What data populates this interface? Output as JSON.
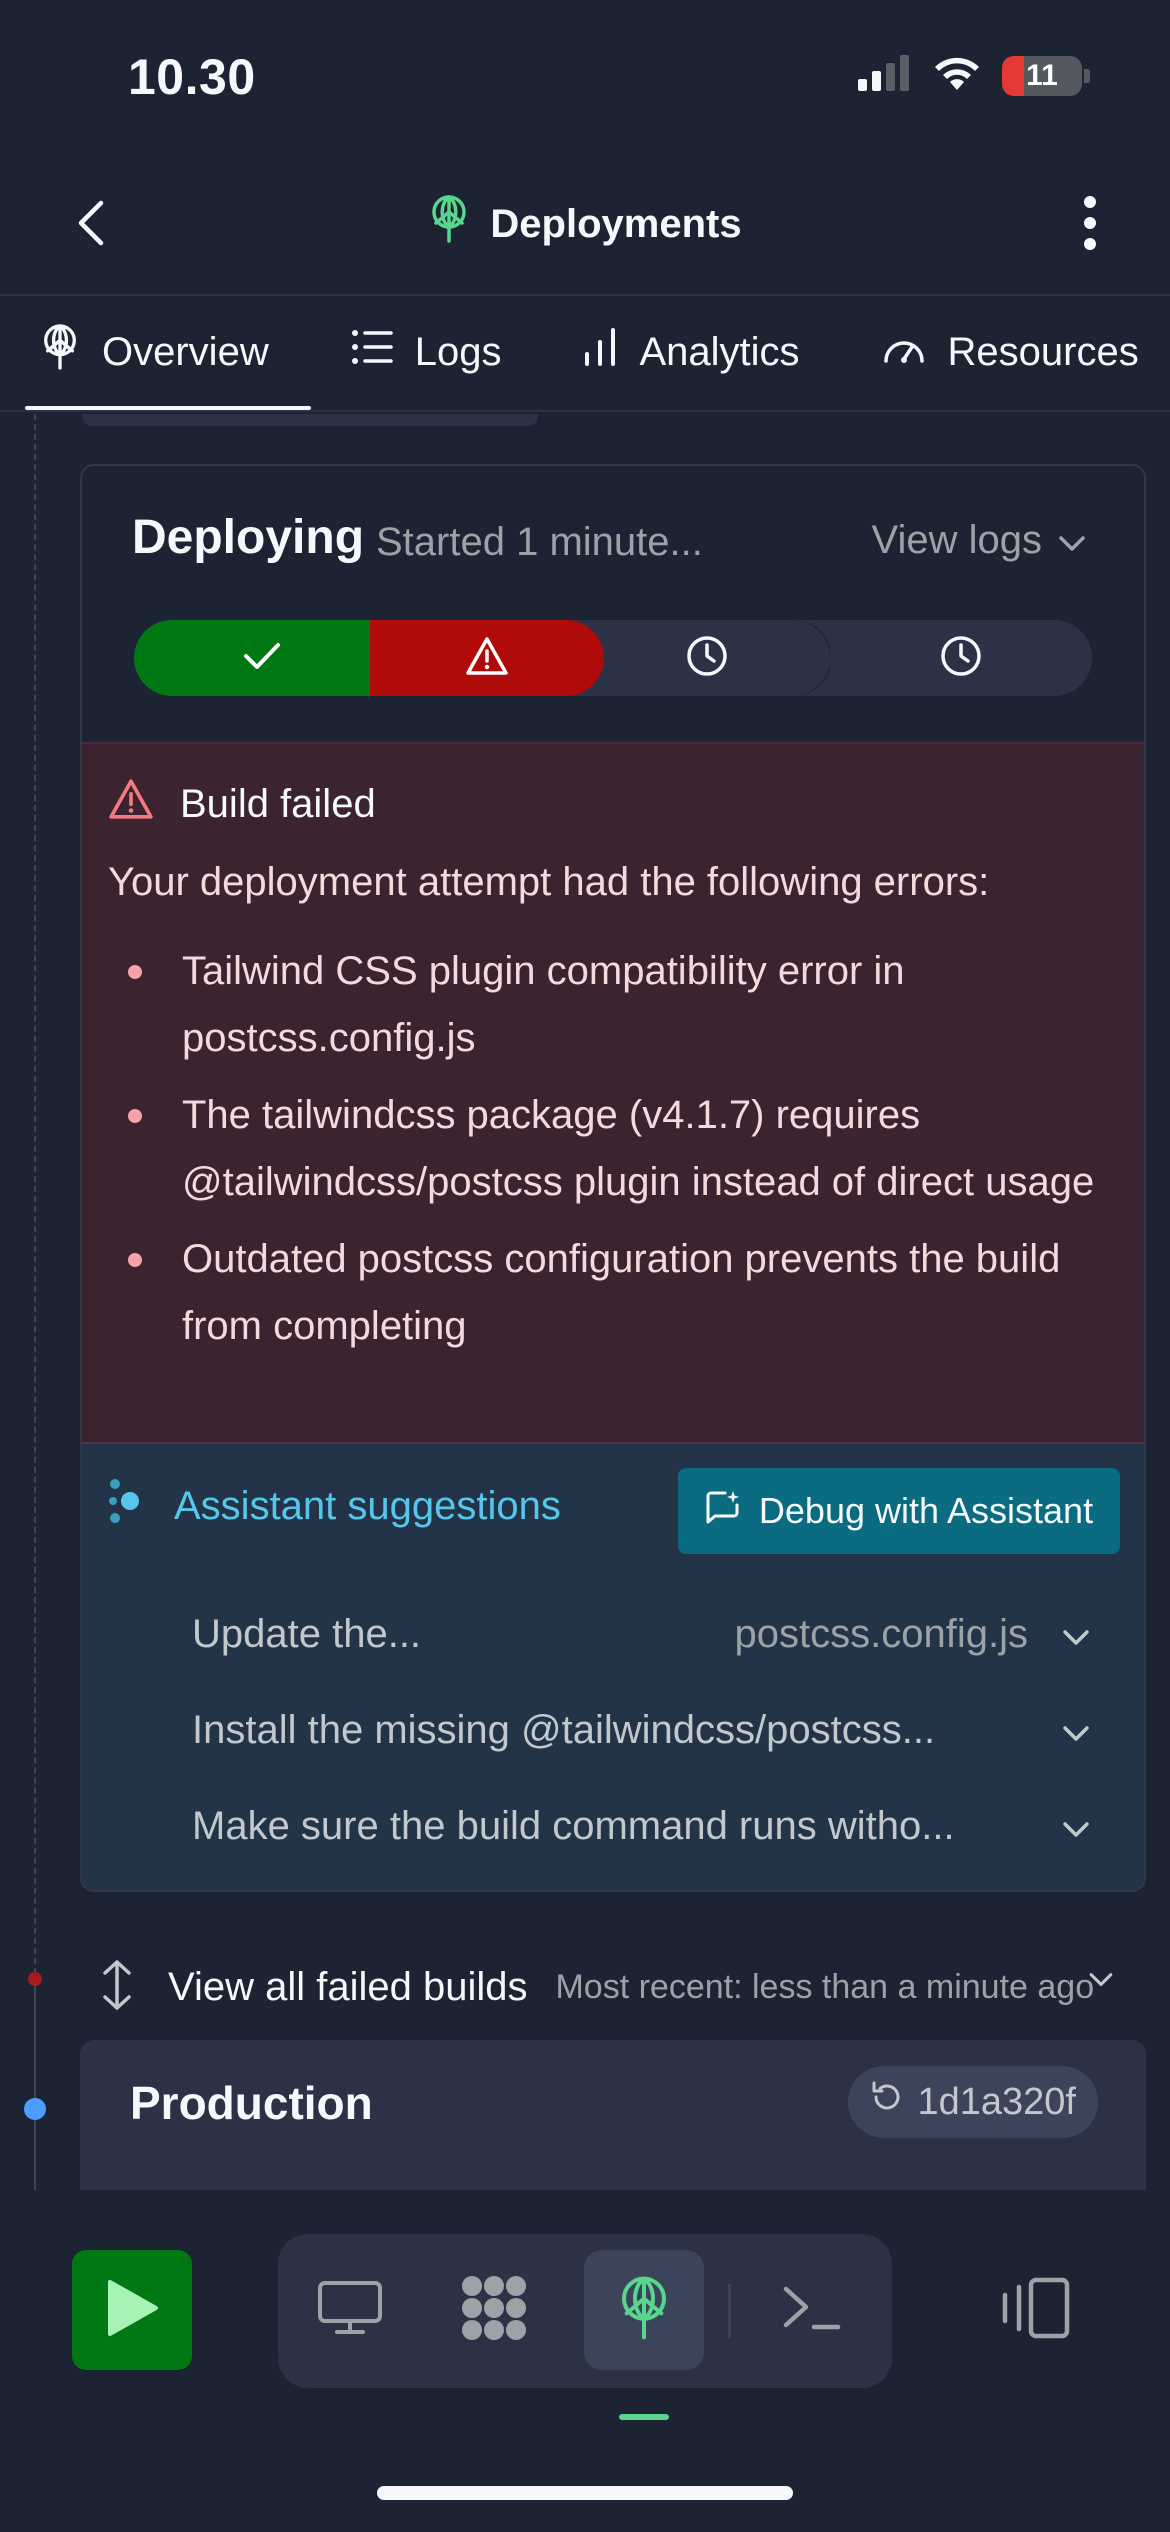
{
  "status_bar": {
    "time": "10.30",
    "battery": "11",
    "icons": [
      "signal-icon",
      "wifi-icon",
      "battery-icon"
    ]
  },
  "header": {
    "title": "Deployments",
    "icons": [
      "back-chevron-icon",
      "deployments-icon",
      "more-vertical-icon"
    ]
  },
  "tabs": [
    {
      "label": "Overview",
      "icon": "deployments-icon",
      "active": true
    },
    {
      "label": "Logs",
      "icon": "list-icon",
      "active": false
    },
    {
      "label": "Analytics",
      "icon": "bar-chart-icon",
      "active": false
    },
    {
      "label": "Resources",
      "icon": "gauge-icon",
      "active": false
    }
  ],
  "deployment": {
    "status": "Deploying",
    "started": "Started 1 minute...",
    "view_logs": "View logs",
    "steps": [
      {
        "state": "done",
        "icon": "check-icon"
      },
      {
        "state": "failed",
        "icon": "warning-icon"
      },
      {
        "state": "pending",
        "icon": "clock-icon"
      },
      {
        "state": "pending",
        "icon": "clock-icon"
      }
    ],
    "error": {
      "title": "Build failed",
      "intro": "Your deployment attempt had the following errors:",
      "items": [
        "Tailwind CSS plugin compatibility error in postcss.config.js",
        "The tailwindcss package (v4.1.7) requires @tailwindcss/postcss plugin instead of direct usage",
        "Outdated postcss configuration prevents the build from completing"
      ]
    },
    "assistant": {
      "title": "Assistant suggestions",
      "debug_button": "Debug with Assistant",
      "suggestions": [
        {
          "text": "Update the...",
          "meta": "postcss.config.js"
        },
        {
          "text": "Install the missing @tailwindcss/postcss...",
          "meta": ""
        },
        {
          "text": "Make sure the build command runs witho...",
          "meta": ""
        }
      ]
    }
  },
  "failed_builds": {
    "label": "View all failed builds",
    "meta": "Most recent: less than a minute ago"
  },
  "production": {
    "title": "Production",
    "commit": "1d1a320f"
  },
  "bottom_bar": {
    "tools": [
      "run-button",
      "preview-icon",
      "workspace-icon",
      "deployments-icon",
      "shell-icon",
      "panels-icon"
    ],
    "active_tool": "deployments-icon"
  },
  "colors": {
    "background": "#1c2333",
    "success": "#007814",
    "error": "#b00b0b",
    "error_bg": "#3b2330",
    "assistant_bg": "#233348",
    "assistant_accent": "#56c7eb",
    "debug_button": "#0b6b81",
    "brand_green": "#58d68d"
  }
}
